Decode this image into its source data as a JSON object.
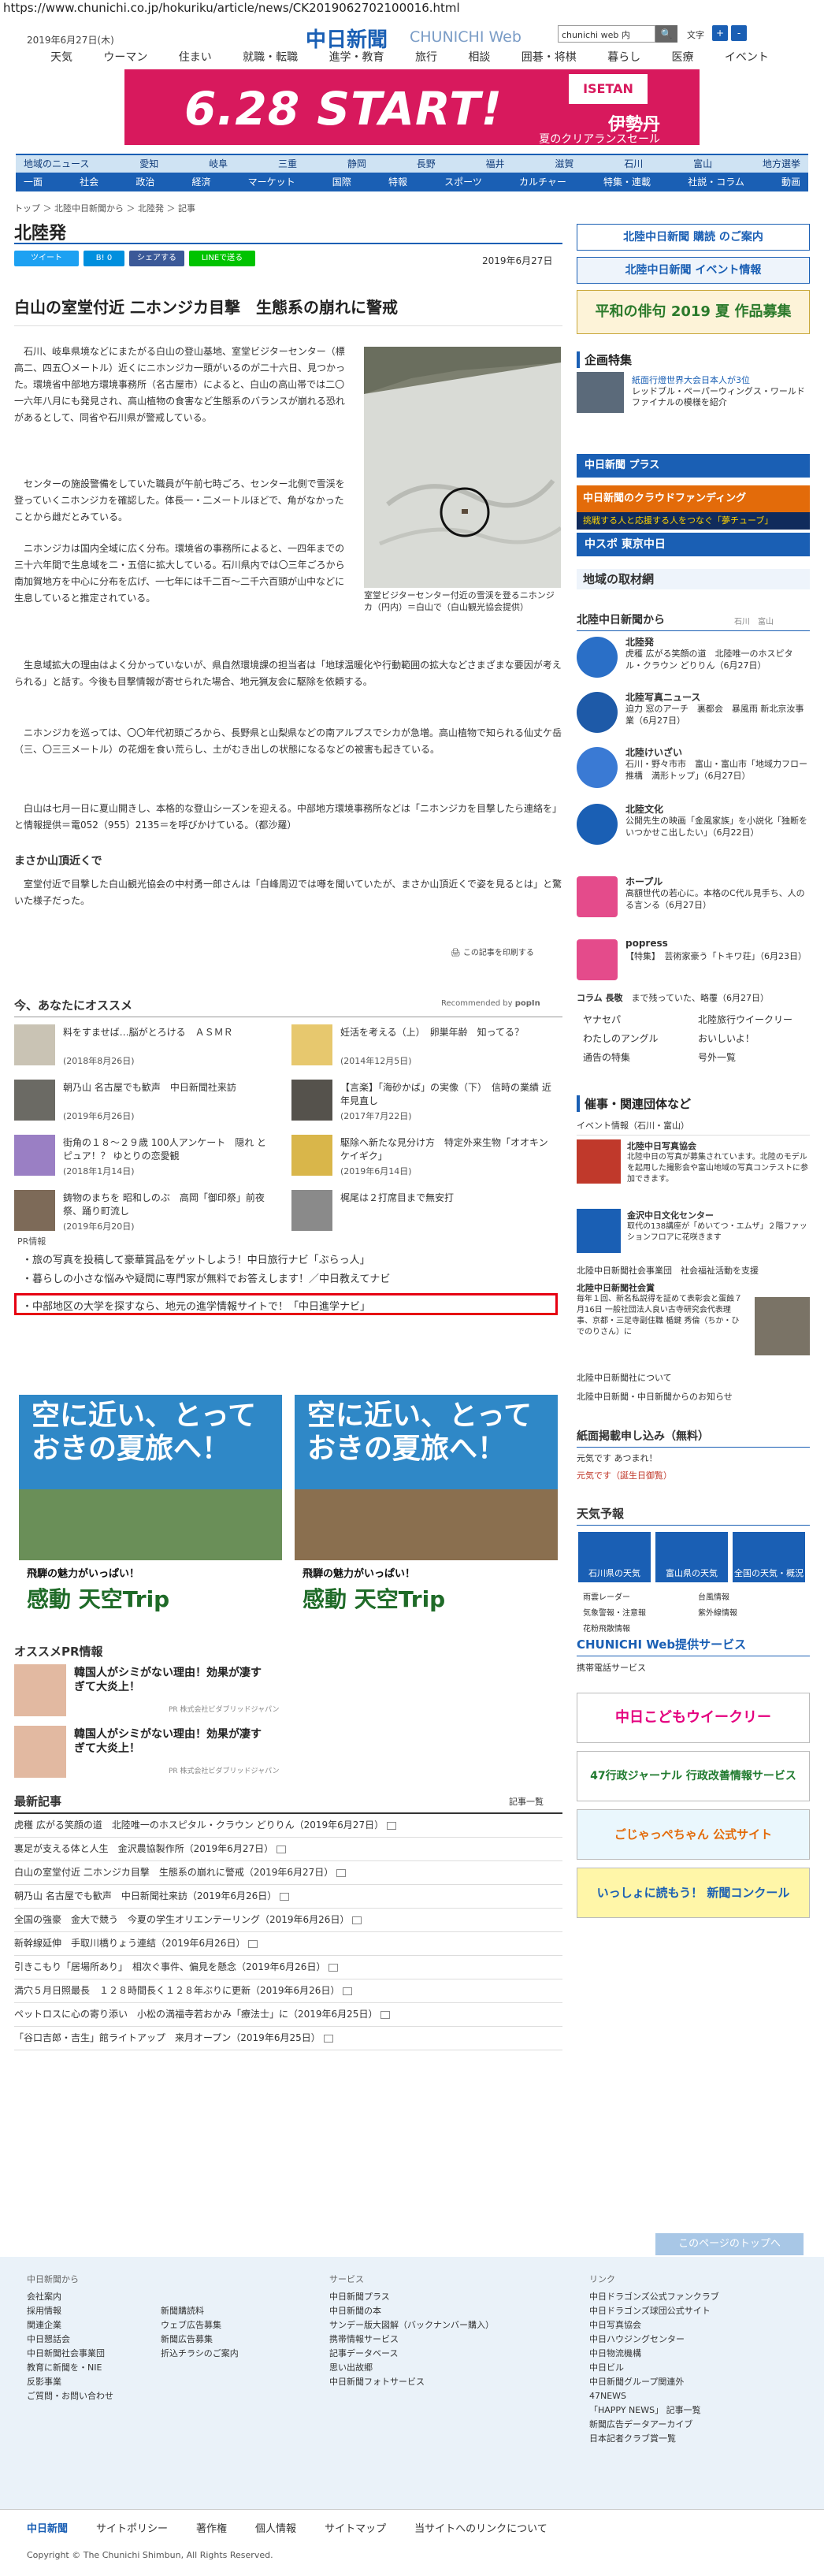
{
  "url": "https://www.chunichi.co.jp/hokuriku/article/news/CK2019062702100016.html",
  "header": {
    "date": "2019年6月27日(木)",
    "logo": "中日新聞",
    "logo_web": "CHUNICHI Web",
    "search_placeholder": "chunichi web 内",
    "search_button": "🔍",
    "font_size_label": "文字",
    "font_plus": "+",
    "font_minus": "-",
    "nav": [
      "天気",
      "ウーマン",
      "住まい",
      "就職・転職",
      "進学・教育",
      "旅行",
      "相談",
      "囲碁・将棋",
      "暮らし",
      "医療",
      "イベント"
    ]
  },
  "banner": {
    "date_text": "6.28 START!",
    "brand": "ISETAN",
    "sub": "伊勢丹",
    "sub2": "夏のクリアランスセール"
  },
  "nav2": [
    "地域のニュース",
    "愛知",
    "岐阜",
    "三重",
    "静岡",
    "長野",
    "福井",
    "滋賀",
    "石川",
    "富山",
    "地方選挙"
  ],
  "nav3": [
    "一面",
    "社会",
    "政治",
    "経済",
    "マーケット",
    "国際",
    "特報",
    "スポーツ",
    "カルチャー",
    "特集・連載",
    "社説・コラム",
    "動画"
  ],
  "breadcrumb": "トップ ＞ 北陸中日新聞から ＞ 北陸発 ＞ 記事",
  "section_title": "北陸発",
  "social": {
    "tweet": "ツイート",
    "hatena": "B! 0",
    "share": "シェアする",
    "line": "LINEで送る"
  },
  "article": {
    "date": "2019年6月27日",
    "headline": "白山の室堂付近 二ホンジカ目撃　生態系の崩れに警戒",
    "p1": "石川、岐阜県境などにまたがる白山の登山基地、室堂ビジターセンター（標高二、四五〇メートル）近くにニホンジカ一頭がいるのが二十六日、見つかった。環境省中部地方環境事務所（名古屋市）によると、白山の高山帯では二〇一六年八月にも発見され、高山植物の食害など生態系のバランスが崩れる恐れがあるとして、同省や石川県が警戒している。",
    "p2": "センターの施設警備をしていた職員が午前七時ごろ、センター北側で雪渓を登っていくニホンジカを確認した。体長一・二メートルほどで、角がなかったことから雌だとみている。",
    "p3": "ニホンジカは国内全域に広く分布。環境省の事務所によると、一四年までの三十六年間で生息域を二・五倍に拡大している。石川県内では〇三年ごろから南加賀地方を中心に分布を広げ、一七年には千二百～二千六百頭が山中などに生息していると推定されている。",
    "p4": "生息域拡大の理由はよく分かっていないが、県自然環境課の担当者は「地球温暖化や行動範囲の拡大などさまざまな要因が考えられる」と話す。今後も目撃情報が寄せられた場合、地元猟友会に駆除を依頼する。",
    "p5": "ニホンジカを巡っては、〇〇年代初頭ごろから、長野県と山梨県などの南アルプスでシカが急増。高山植物で知られる仙丈ケ岳（三、〇三三メートル）の花畑を食い荒らし、土がむき出しの状態になるなどの被害も起きている。",
    "p6": "白山は七月一日に夏山開きし、本格的な登山シーズンを迎える。中部地方環境事務所などは「ニホンジカを目撃したら連絡を」と情報提供＝電052（955）2135＝を呼びかけている。（都沙羅）",
    "caption": "室堂ビジターセンター付近の雪渓を登るニホンジカ（円内）＝白山で（白山観光協会提供）",
    "subhead": "まさか山頂近くで",
    "p7": "室堂付近で目撃した白山観光協会の中村勇一郎さんは「白峰周辺では噂を聞いていたが、まさか山頂近くで姿を見るとは」と驚いた様子だった。",
    "print": "この記事を印刷する"
  },
  "recommend": {
    "title": "今、あなたにオススメ",
    "by": "Recommended by",
    "logo": "popIn",
    "items": [
      {
        "t": "料をすませば…脳がとろける　ＡＳＭＲ",
        "d": "(2018年8月26日)"
      },
      {
        "t": "妊活を考える（上）　卵巣年齢　知ってる？",
        "d": "(2014年12月5日)"
      },
      {
        "t": "朝乃山 名古屋でも歓声　中日新聞社来訪",
        "d": "(2019年6月26日)"
      },
      {
        "t": "【言楽】「海砂かば」の実像（下）　信時の業績 近年見直し",
        "d": "(2017年7月22日)"
      },
      {
        "t": "街角の１８～２９歳 100人アンケート　隠れ とピュア！？ ゆとりの恋愛観",
        "d": "(2018年1月14日)"
      },
      {
        "t": "駆除へ新たな見分け方　特定外来生物「オオキンケイギク」",
        "d": "(2019年6月14日)"
      },
      {
        "t": "鋳物のまちを 昭和しのぶ　高岡「御印祭」前夜祭、踊り町流し",
        "d": "(2019年6月20日)"
      },
      {
        "t": "梶尾は２打席目まで無安打",
        "d": ""
      }
    ]
  },
  "pr": {
    "label": "PR情報",
    "lines": [
      "・旅の写真を投稿して豪華賞品をゲットしよう！中日旅行ナビ「ぶらっ人」",
      "・暮らしの小さな悩みや疑問に専門家が無料でお答えします！／中日教えてナビ",
      "・中部地区の大学を探すなら、地元の進学情報サイトで！「中日進学ナビ」"
    ]
  },
  "ads": {
    "title": "空に近い、とっておきの夏旅へ！",
    "sub": "飛騨の魅力がいっぱい！",
    "brand": "感動 天空Trip"
  },
  "osusume_pr": {
    "title": "オススメPR情報",
    "items": [
      {
        "t": "韓国人がシミがない理由！効果が凄すぎて大炎上！",
        "pr": "PR 株式会社ビダブリッドジャパン"
      },
      {
        "t": "韓国人がシミがない理由！効果が凄すぎて大炎上！",
        "pr": "PR 株式会社ビダブリッドジャパン"
      }
    ]
  },
  "latest": {
    "title": "最新記事",
    "btn": "記事一覧",
    "items": [
      "虎穫 広がる笑顔の道　北陸唯一のホスピタル・クラウン どりりん（2019年6月27日）",
      "裏足が支える体と人生　金沢農協製作所（2019年6月27日）",
      "白山の室堂付近 二ホンジカ目撃　生態系の崩れに警戒（2019年6月27日）",
      "朝乃山 名古屋でも歓声　中日新聞社来訪（2019年6月26日）",
      "全国の強豪　金大で競う　今夏の学生オリエンテーリング（2019年6月26日）",
      "新幹線延伸　手取川橋りょう連結（2019年6月26日）",
      "引きこもり「居場所あり」　相次ぐ事件、偏見を懸念（2019年6月26日）",
      "満穴５月日照最長　１２８時間長く１２８年ぶりに更新（2019年6月26日）",
      "ペットロスに心の寄り添い　小松の満福寺若おかみ「療法士」に（2019年6月25日）",
      "「谷口吉郎・吉生」館ライトアップ　来月オープン（2019年6月25日）"
    ]
  },
  "right": {
    "subscribe": "北陸中日新聞 購読 のご案内",
    "event": "北陸中日新聞 イベント情報",
    "haiku": "平和の俳句 2019 夏 作品募集",
    "kikaku": "企画特集",
    "kikaku_items": [
      {
        "n": "紙面行燈世界大会日本人が3位",
        "x": ""
      },
      {
        "n": "レッドブル・ペーパーウィングス・ワールドファイナルの模様を紹介",
        "x": ""
      }
    ],
    "plus": "中日新聞 プラス",
    "cf": "中日新聞のクラウドファンディング",
    "cf_sub": "挑戦する人と応援する人をつなぐ「夢チューブ」",
    "chuspo": "中スポ 東京中日",
    "chiiki": "地域の取材網",
    "hokuriku_from": "北陸中日新聞から",
    "hokuriku_tabs": "石川　富山",
    "list": [
      {
        "n": "北陸発",
        "x": "虎穫 広がる笑顔の道　北陸唯一のホスピタル・クラウン どりりん（6月27日）"
      },
      {
        "n": "北陸写真ニュース",
        "x": "迫力 窓のアーチ　裏都会　暴風雨 新北京汝事業（6月27日）"
      },
      {
        "n": "北陸けいざい",
        "x": "石川・野々市市　富山・富山市「地域力フロー推構　満形トップ」（6月27日）"
      },
      {
        "n": "北陸文化",
        "x": "公開先生の映画「金風家族」を小説化「独断をいつかせこ出したい」（6月22日）"
      },
      {
        "n": "ホープル",
        "x": "高額世代の若心に。本格のC代ル見手ち、人のる言ンる（6月27日）"
      },
      {
        "n": "popress",
        "x": "【特集】　芸術家豪う「トキワ荘」（6月23日）"
      }
    ],
    "column_label": "コラム 長敬",
    "column_text": "まで残っていた、略覆（6月27日）",
    "links": [
      "ヤナセパ",
      "北陸旅行ウイークリー",
      "わたしのアングル",
      "おいしいよ！",
      "通告の特集",
      "号外一覧"
    ],
    "saiji": "催事・関連団体など",
    "saiji_sub": "イベント情報（石川・富山）",
    "saiji_items": [
      {
        "n": "北陸中日写真協会",
        "x": "北陸中日の写真が募集されています。北陸のモデルを起用した撮影会や富山地域の写真コンテストに参加できます。"
      },
      {
        "n": "金沢中日文化センター",
        "x": "取代の138講座が「めいてつ・エムザ」２階ファッションフロアに花咲きます"
      }
    ],
    "social_work": "北陸中日新聞社会事業団　社会福祉活動を支援",
    "award": "北陸中日新聞社会賞",
    "award_x": "毎年１回、新名私説得を証めて表彰会と蛋蝕７月16日 一般社団法人良い古寺研究会代表理事、京都・三足寺副住職 楯鍵 秀倫（ちか・ひでのりさん）に",
    "office": "北陸中日新聞社について",
    "office2": "北陸中日新聞・中日新聞からのお知らせ",
    "shimen": "紙面掲載申し込み（無料）",
    "shimen1": "元気です あつまれ！",
    "shimen2": "元気です（誕生日御覧）",
    "weather": "天気予報",
    "w1": "石川県の天気",
    "w2": "富山県の天気",
    "w3": "全国の天気・概況",
    "wlinks": [
      "雨雲レーダー",
      "台風情報",
      "気象警報・注意報",
      "紫外線情報",
      "花粉飛散情報"
    ],
    "services": "CHUNICHI Web提供サービス",
    "services_sub": "携帯電話サービス",
    "s1": "中日こどもウイークリー",
    "s2": "47行政ジャーナル 行政改善情報サービス",
    "s3": "ごじゃっぺちゃん 公式サイト",
    "s4": "いっしょに読もう！ 新聞コンクール"
  },
  "footer": {
    "toTop": "このページのトップへ",
    "col1_title": "中日新聞から",
    "col1": [
      "会社案内",
      "採用情報",
      "関連企業",
      "中日懇話会",
      "中日新聞社会事業団",
      "教育に新聞を・NIE",
      "反影事業",
      "ご質問・お問い合わせ"
    ],
    "col2": [
      "新聞購読料",
      "ウェブ広告募集",
      "新聞広告募集",
      "折込チラシのご案内"
    ],
    "col3_title": "サービス",
    "col3": [
      "中日新聞プラス",
      "中日新聞の本",
      "サンデー版大図解（バックナンバー購入）",
      "携帯情報サービス",
      "記事データベース",
      "思い出故郷",
      "中日新聞フォトサービス"
    ],
    "col4_title": "リンク",
    "col4": [
      "中日ドラゴンズ公式ファンクラブ",
      "中日ドラゴンズ球団公式サイト",
      "中日写真協会",
      "中日ハウジングセンター",
      "中日物流機構",
      "中日ビル",
      "中日新聞グループ関連外",
      "47NEWS",
      "「HAPPY NEWS」 記事一覧",
      "新聞広告データアーカイブ",
      "日本記者クラブ賞一覧"
    ],
    "nav": [
      "中日新聞",
      "サイトポリシー",
      "著作権",
      "個人情報",
      "サイトマップ",
      "当サイトへのリンクについて"
    ],
    "copyright": "Copyright © The Chunichi Shimbun, All Rights Reserved."
  }
}
